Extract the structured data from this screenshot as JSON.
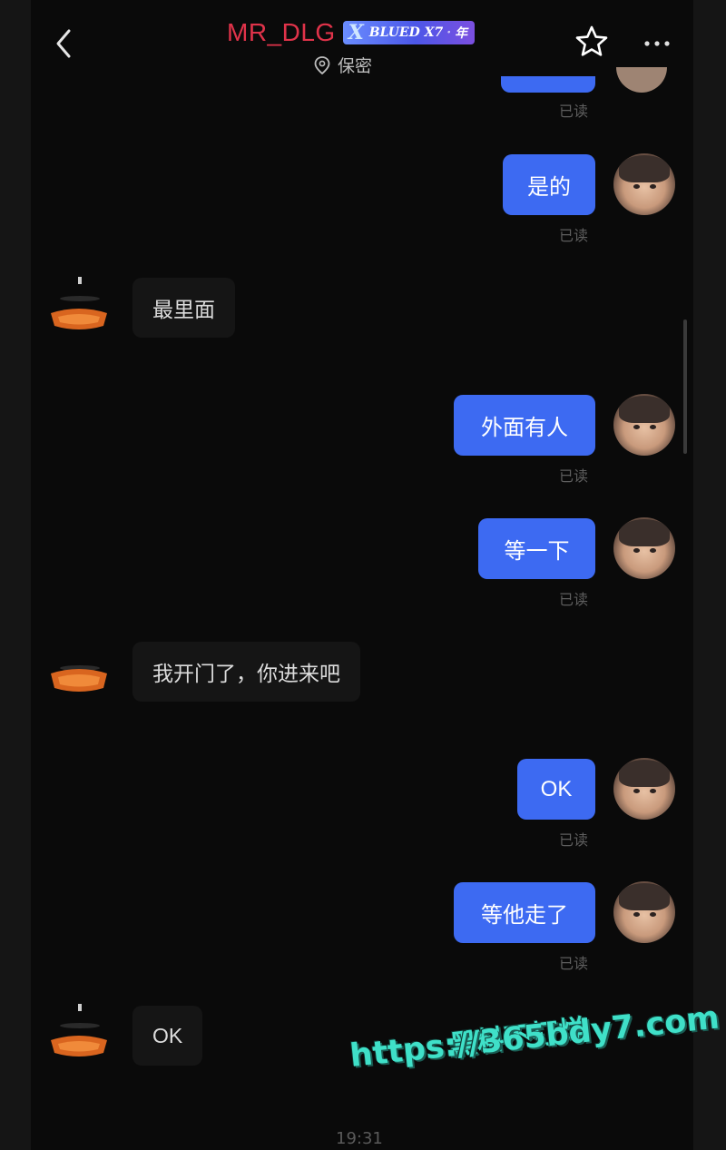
{
  "header": {
    "title": "MR_DLG",
    "badge": {
      "x": "X",
      "text": "BLUED X7",
      "suffix": "年"
    },
    "location": "保密",
    "back_icon": "chevron-left-icon",
    "star_icon": "star-outline-icon",
    "more_icon": "more-dots-icon"
  },
  "messages": [
    {
      "from": "me",
      "text": "是的",
      "status": "已读"
    },
    {
      "from": "other",
      "text": "最里面"
    },
    {
      "from": "me",
      "text": "外面有人",
      "status": "已读"
    },
    {
      "from": "me",
      "text": "等一下",
      "status": "已读"
    },
    {
      "from": "other",
      "text": "我开门了，你进来吧"
    },
    {
      "from": "me",
      "text": "OK",
      "status": "已读"
    },
    {
      "from": "me",
      "text": "等他走了",
      "status": "已读"
    },
    {
      "from": "other",
      "text": "OK"
    }
  ],
  "peek_status": "已读",
  "timestamp": "19:31",
  "watermark": {
    "line1": "黑料不打烊",
    "line2": "https://365bdy7.com"
  },
  "colors": {
    "outgoing_bubble": "#3d6af2",
    "incoming_bubble": "#151515",
    "title": "#e0334a",
    "watermark": "#3fe0c8"
  }
}
